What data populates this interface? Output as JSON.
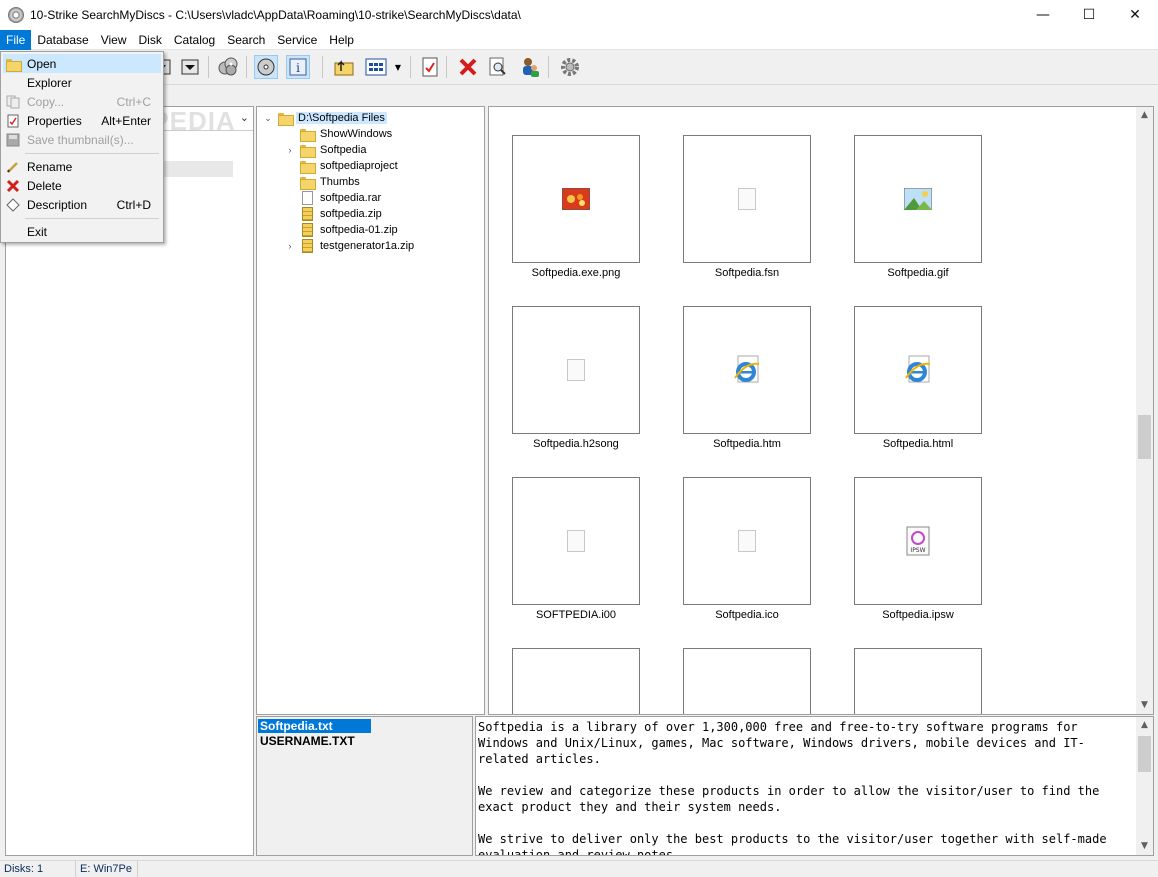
{
  "window": {
    "title": "10-Strike SearchMyDiscs - C:\\Users\\vladc\\AppData\\Roaming\\10-strike\\SearchMyDiscs\\data\\",
    "controls": {
      "minimize": "—",
      "maximize": "☐",
      "close": "✕"
    }
  },
  "menubar": {
    "items": [
      "File",
      "Database",
      "View",
      "Disk",
      "Catalog",
      "Search",
      "Service",
      "Help"
    ]
  },
  "file_menu": {
    "items": [
      {
        "label": "Open",
        "shortcut": "",
        "icon": "folder-open-icon"
      },
      {
        "label": "Explorer",
        "shortcut": "",
        "icon": ""
      },
      {
        "label": "Copy...",
        "shortcut": "Ctrl+C",
        "icon": "copy-icon"
      },
      {
        "label": "Properties",
        "shortcut": "Alt+Enter",
        "icon": "properties-icon"
      },
      {
        "label": "Save thumbnail(s)...",
        "shortcut": "",
        "icon": "save-icon"
      },
      {
        "label": "Rename",
        "shortcut": "",
        "icon": "rename-icon"
      },
      {
        "label": "Delete",
        "shortcut": "",
        "icon": "delete-icon"
      },
      {
        "label": "Description",
        "shortcut": "Ctrl+D",
        "icon": "description-icon"
      },
      {
        "label": "Exit",
        "shortcut": "",
        "icon": ""
      }
    ]
  },
  "watermark": "SOFTPEDIA",
  "tree": {
    "root": "D:\\Softpedia Files",
    "items": [
      {
        "label": "ShowWindows",
        "type": "folder"
      },
      {
        "label": "Softpedia",
        "type": "folder"
      },
      {
        "label": "softpediaproject",
        "type": "folder"
      },
      {
        "label": "Thumbs",
        "type": "folder"
      },
      {
        "label": "softpedia.rar",
        "type": "file"
      },
      {
        "label": "softpedia.zip",
        "type": "zip"
      },
      {
        "label": "softpedia-01.zip",
        "type": "zip"
      },
      {
        "label": "testgenerator1a.zip",
        "type": "zip"
      }
    ]
  },
  "thumbnails": [
    {
      "label": "Softpedia.exe.png",
      "icon": "image-flower-icon"
    },
    {
      "label": "Softpedia.fsn",
      "icon": "blank-doc-icon"
    },
    {
      "label": "Softpedia.gif",
      "icon": "image-landscape-icon"
    },
    {
      "label": "Softpedia.h2song",
      "icon": "blank-doc-icon"
    },
    {
      "label": "Softpedia.htm",
      "icon": "internet-explorer-icon"
    },
    {
      "label": "Softpedia.html",
      "icon": "internet-explorer-icon"
    },
    {
      "label": "SOFTPEDIA.i00",
      "icon": "blank-doc-icon"
    },
    {
      "label": "Softpedia.ico",
      "icon": "blank-doc-icon"
    },
    {
      "label": "Softpedia.ipsw",
      "icon": "ipsw-icon"
    }
  ],
  "ipsw_badge": "IPSW",
  "file_list": [
    "Softpedia.txt",
    "USERNAME.TXT"
  ],
  "preview_text": "Softpedia is a library of over 1,300,000 free and free-to-try software programs for Windows and Unix/Linux, games, Mac software, Windows drivers, mobile devices and IT-related articles.\n\nWe review and categorize these products in order to allow the visitor/user to find the exact product they and their system needs.\n\nWe strive to deliver only the best products to the visitor/user together with self-made evaluation and review notes.",
  "statusbar": {
    "disks": "Disks: 1",
    "drive": "E: Win7Pe"
  },
  "colors": {
    "accent": "#0078d7",
    "selection": "#cce8ff"
  }
}
